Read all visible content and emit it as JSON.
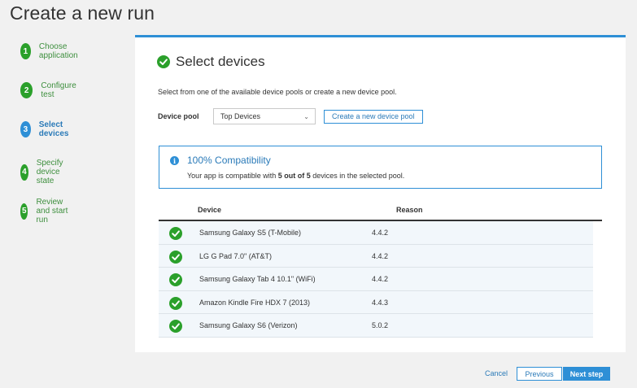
{
  "page": {
    "title": "Create a new run"
  },
  "steps": [
    {
      "number": "1",
      "label": "Choose application",
      "state": "done"
    },
    {
      "number": "2",
      "label": "Configure test",
      "state": "done"
    },
    {
      "number": "3",
      "label": "Select devices",
      "state": "active"
    },
    {
      "number": "4",
      "label": "Specify device state",
      "state": "done"
    },
    {
      "number": "5",
      "label": "Review and start run",
      "state": "done"
    }
  ],
  "panel": {
    "title": "Select devices",
    "description": "Select from one of the available device pools or create a new device pool.",
    "device_pool": {
      "label": "Device pool",
      "selected": "Top Devices",
      "create_button": "Create a new device pool"
    },
    "compatibility": {
      "title": "100% Compatibility",
      "message_prefix": "Your app is compatible with ",
      "message_bold": "5 out of 5",
      "message_suffix": " devices in the selected pool."
    },
    "table": {
      "headers": {
        "device": "Device",
        "reason": "Reason"
      },
      "rows": [
        {
          "device": "Samsung Galaxy S5 (T-Mobile)",
          "reason": "4.4.2"
        },
        {
          "device": "LG G Pad 7.0\" (AT&T)",
          "reason": "4.4.2"
        },
        {
          "device": "Samsung Galaxy Tab 4 10.1\" (WiFi)",
          "reason": "4.4.2"
        },
        {
          "device": "Amazon Kindle Fire HDX 7 (2013)",
          "reason": "4.4.3"
        },
        {
          "device": "Samsung Galaxy S6 (Verizon)",
          "reason": "5.0.2"
        }
      ]
    }
  },
  "footer": {
    "cancel_label": "Cancel",
    "previous_label": "Previous",
    "next_label": "Next step"
  },
  "colors": {
    "accent": "#2e8fd6",
    "success": "#2ba02b",
    "row_bg": "#f2f7fb"
  },
  "icons": {
    "step_check": "check-circle-icon",
    "info": "info-icon",
    "dropdown": "chevron-down-icon"
  }
}
